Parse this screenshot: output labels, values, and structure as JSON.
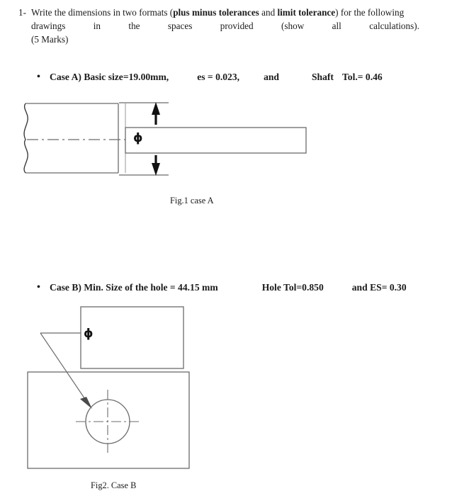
{
  "document": {
    "title": "Engineering Tolerance Worksheet",
    "ink_color": "#1b1b1b",
    "line_color": "#6b6b6b",
    "background": "#ffffff"
  },
  "question": {
    "number": "1-",
    "line1_a": "Write the dimensions in two formats (",
    "line1_bold1": "plus minus tolerances",
    "line1_b": " and ",
    "line1_bold2": "limit tolerance",
    "line1_c": ") for the following",
    "line2_words": [
      "drawings",
      "in",
      "the",
      "spaces",
      "provided",
      "(show",
      "all",
      "calculations)."
    ],
    "line3": "(5 Marks)"
  },
  "cases": [
    {
      "bullet": "•",
      "label": "Case A) Basic size=19.00mm,",
      "param1": "es = 0.023,",
      "conjunction": "and",
      "param2": "Shaft",
      "param3": "Tol.= 0.46",
      "caption": "Fig.1 case A",
      "diameter_symbol": "ϕ"
    },
    {
      "bullet": "•",
      "label": "Case B) Min. Size of the hole  = 44.15 mm",
      "param1": "Hole Tol=0.850",
      "conjunction": "",
      "param2": "and ES= 0.30",
      "param3": "",
      "caption": "Fig2. Case B",
      "diameter_symbol": "ϕ"
    }
  ]
}
